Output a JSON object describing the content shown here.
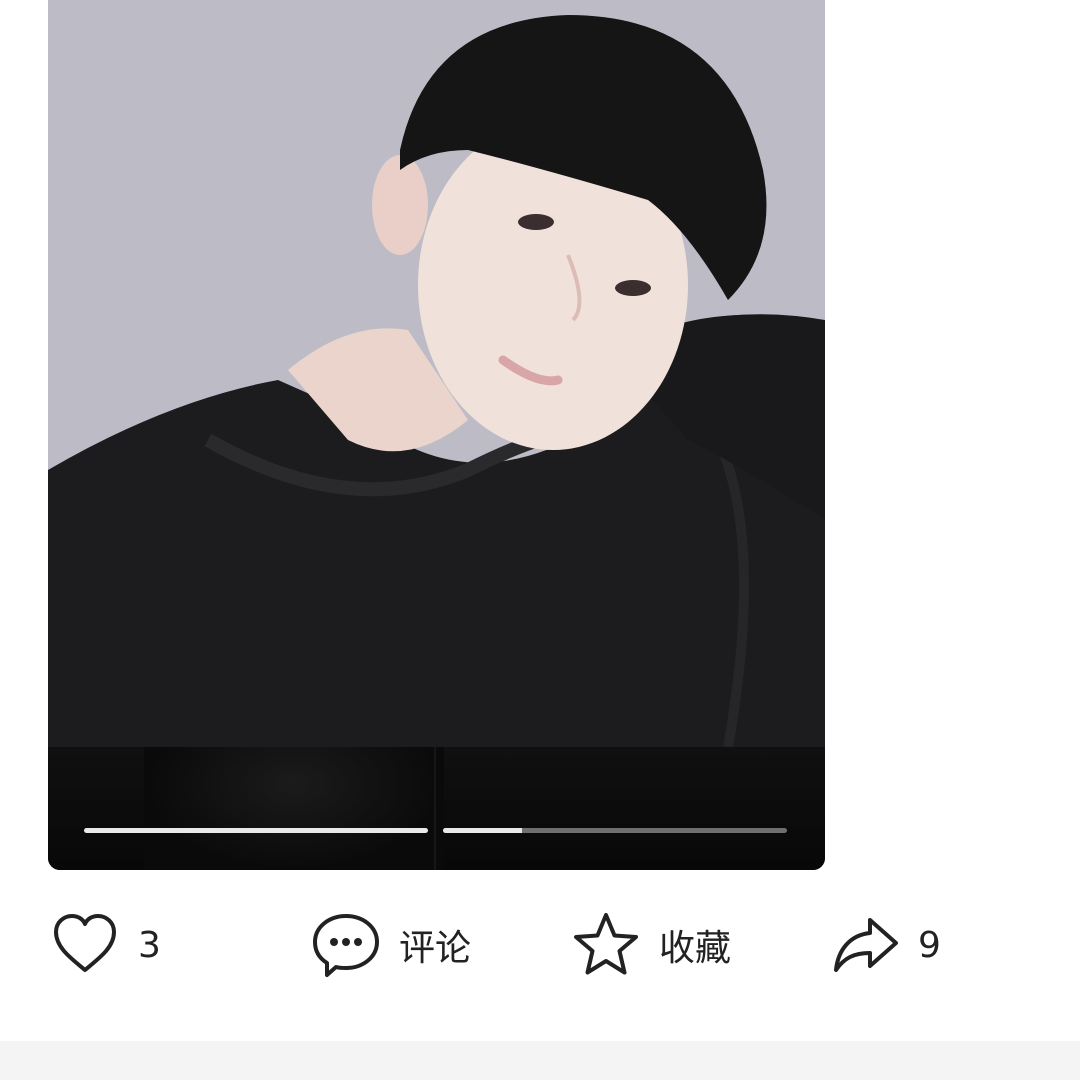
{
  "post": {
    "media": {
      "progress_segments": [
        1.0,
        0.23
      ]
    },
    "actions": {
      "like": {
        "icon": "heart-icon",
        "count": "3"
      },
      "comment": {
        "icon": "comment-icon",
        "label": "评论"
      },
      "collect": {
        "icon": "star-icon",
        "label": "收藏"
      },
      "share": {
        "icon": "share-icon",
        "count": "9"
      }
    }
  },
  "colors": {
    "icon_stroke": "#222222",
    "progress_active": "#e9e9e9",
    "progress_inactive": "#6f6f6f",
    "footer_bg": "#f4f4f4"
  }
}
